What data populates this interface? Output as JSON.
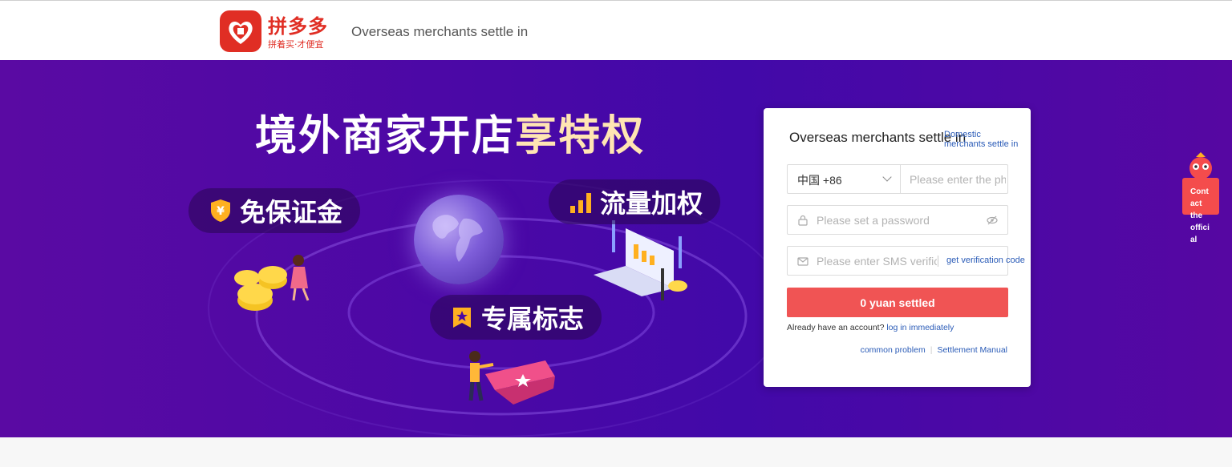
{
  "header": {
    "brand_name": "拼多多",
    "brand_slogan": "拼着买·才便宜",
    "title": "Overseas merchants settle in"
  },
  "banner": {
    "headline_main": "境外商家开店",
    "headline_highlight": "享特权",
    "features": [
      {
        "label": "免保证金",
        "icon": "yuan-shield-icon"
      },
      {
        "label": "流量加权",
        "icon": "bar-signal-icon"
      },
      {
        "label": "专属标志",
        "icon": "star-badge-icon"
      }
    ]
  },
  "login_card": {
    "title": "Overseas merchants settle in",
    "switch_link": "Domestic merchants settle in",
    "country_code": "中国 +86",
    "phone_placeholder": "Please enter the phone number",
    "password_placeholder": "Please set a password",
    "sms_placeholder": "Please enter SMS verification code",
    "get_code": "get verification code",
    "submit": "0 yuan settled",
    "account_prompt": "Already have an account?",
    "login_link": "log in immediately",
    "common_problem": "common problem",
    "settlement_manual": "Settlement Manual"
  },
  "contact": {
    "label": "Contact the official"
  },
  "colors": {
    "brand_red": "#e02e24",
    "button_red": "#f05454",
    "link_blue": "#2a5bb7",
    "banner_purple": "#4a08a6",
    "highlight_gold": "#ffe5b3"
  }
}
